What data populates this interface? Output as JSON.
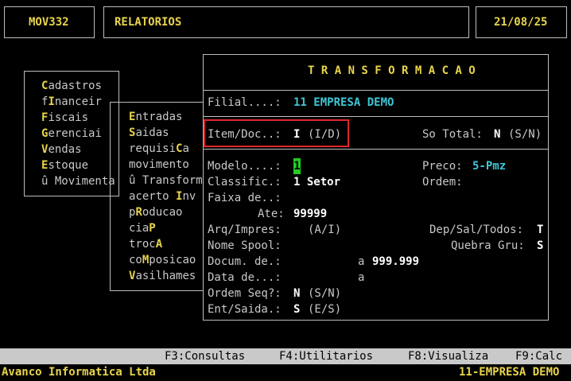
{
  "header": {
    "program": "MOV332",
    "module": "RELATORIOS",
    "date": "21/08/25"
  },
  "main_menu": {
    "items": [
      {
        "hot": "C",
        "rest": "adastros"
      },
      {
        "pre": "f",
        "hot": "I",
        "rest": "nanceir"
      },
      {
        "hot": "F",
        "rest": "iscais"
      },
      {
        "hot": "G",
        "rest": "erenciai"
      },
      {
        "hot": "V",
        "rest": "endas"
      },
      {
        "hot": "E",
        "rest": "stoque"
      },
      {
        "pre": "û ",
        "rest": "Movimenta"
      }
    ]
  },
  "sub_menu": {
    "items": [
      {
        "hot": "E",
        "rest": "ntradas"
      },
      {
        "hot": "S",
        "rest": "aidas"
      },
      {
        "pre": "requisi",
        "hot": "C",
        "rest": "a"
      },
      {
        "pre": "movimento",
        "rest": ""
      },
      {
        "pre": "û ",
        "rest": "Transform"
      },
      {
        "pre": "acerto ",
        "hot": "I",
        "rest": "nv"
      },
      {
        "pre": "p",
        "hot": "R",
        "rest": "oducao"
      },
      {
        "pre": "cia",
        "hot": "P",
        "rest": ""
      },
      {
        "pre": "troc",
        "hot": "A",
        "rest": ""
      },
      {
        "pre": "co",
        "hot": "M",
        "rest": "posicao"
      },
      {
        "hot": "V",
        "rest": "asilhames"
      }
    ]
  },
  "dialog": {
    "title": "T R A N S F O R M A C A O",
    "filial_label": "Filial....:",
    "filial_value": "11 EMPRESA DEMO",
    "item_doc_label": "Item/Doc..:",
    "item_doc_value": "I",
    "item_doc_hint": "(I/D)",
    "so_total_label": "So Total:",
    "so_total_value": "N",
    "so_total_hint": "(S/N)",
    "modelo_label": "Modelo....:",
    "modelo_value": "1",
    "preco_label": "Preco:",
    "preco_value": "5-Pmz",
    "classific_label": "Classific.:",
    "classific_value": "1 Setor",
    "ordem_label": "Ordem:",
    "faixa_label": "Faixa de..:",
    "ate_label": "Ate:",
    "ate_value": "99999",
    "arq_label": "Arq/Impres:",
    "arq_hint": "(A/I)",
    "dep_label": "Dep/Sal/Todos:",
    "dep_value": "T",
    "nome_spool_label": "Nome Spool:",
    "quebra_label": "Quebra Gru:",
    "quebra_value": "S",
    "docum_label": "Docum. de.:",
    "docum_a": "a",
    "docum_value": "999.999",
    "data_label": "Data de...:",
    "data_a": "a",
    "ordem_seq_label": "Ordem Seq?:",
    "ordem_seq_value": "N",
    "ordem_seq_hint": "(S/N)",
    "ent_saida_label": "Ent/Saida.:",
    "ent_saida_value": "S",
    "ent_saida_hint": "(E/S)"
  },
  "function_bar": {
    "f3": "F3:Consultas",
    "f4": "F4:Utilitarios",
    "f8": "F8:Visualiza",
    "f9": "F9:Calc"
  },
  "status_bar": {
    "company": "Avanco Informatica Ltda",
    "branch": "11-EMPRESA DEMO"
  }
}
